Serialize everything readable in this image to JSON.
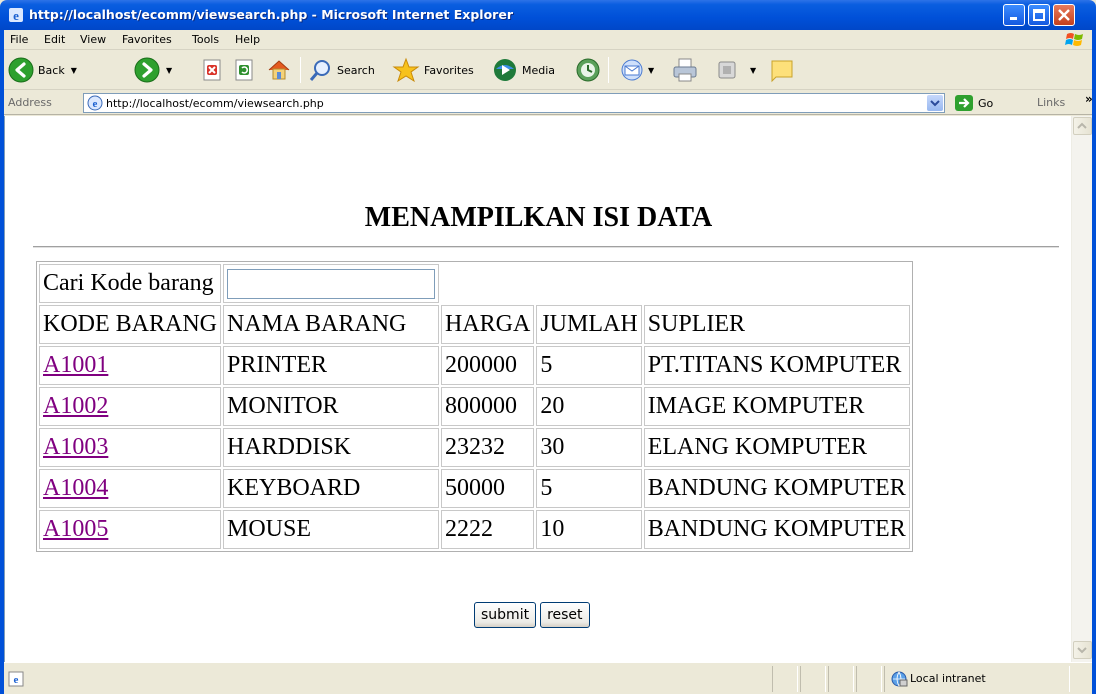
{
  "window": {
    "title": "http://localhost/ecomm/viewsearch.php - Microsoft Internet Explorer"
  },
  "menu": {
    "file": "File",
    "edit": "Edit",
    "view": "View",
    "favorites": "Favorites",
    "tools": "Tools",
    "help": "Help"
  },
  "toolbar": {
    "back": "Back",
    "search": "Search",
    "favorites": "Favorites",
    "media": "Media"
  },
  "address": {
    "label": "Address",
    "url": "http://localhost/ecomm/viewsearch.php",
    "go": "Go",
    "links": "Links"
  },
  "page": {
    "heading": "MENAMPILKAN ISI DATA",
    "search_label": "Cari Kode barang",
    "search_value": "",
    "columns": [
      "KODE BARANG",
      "NAMA BARANG",
      "HARGA",
      "JUMLAH",
      "SUPLIER"
    ],
    "rows": [
      {
        "kode": "A1001",
        "nama": "PRINTER",
        "harga": "200000",
        "jumlah": "5",
        "suplier": "PT.TITANS KOMPUTER"
      },
      {
        "kode": "A1002",
        "nama": "MONITOR",
        "harga": "800000",
        "jumlah": "20",
        "suplier": "IMAGE KOMPUTER"
      },
      {
        "kode": "A1003",
        "nama": "HARDDISK",
        "harga": "23232",
        "jumlah": "30",
        "suplier": "ELANG KOMPUTER"
      },
      {
        "kode": "A1004",
        "nama": "KEYBOARD",
        "harga": "50000",
        "jumlah": "5",
        "suplier": "BANDUNG KOMPUTER"
      },
      {
        "kode": "A1005",
        "nama": "MOUSE",
        "harga": "2222",
        "jumlah": "10",
        "suplier": "BANDUNG KOMPUTER"
      }
    ],
    "submit_label": "submit",
    "reset_label": "reset"
  },
  "status": {
    "zone": "Local intranet"
  },
  "colors": {
    "titlebar": "#0050d8",
    "visited_link": "#800080",
    "chrome": "#ece9d8"
  },
  "icons": [
    "ie-icon",
    "minimize-icon",
    "maximize-icon",
    "close-icon",
    "windows-logo-icon",
    "back-icon",
    "forward-icon",
    "stop-icon",
    "refresh-icon",
    "home-icon",
    "search-icon",
    "favorites-star-icon",
    "media-icon",
    "history-icon",
    "mail-icon",
    "print-icon",
    "edit-icon",
    "messenger-icon",
    "go-arrow-icon",
    "local-intranet-icon"
  ]
}
